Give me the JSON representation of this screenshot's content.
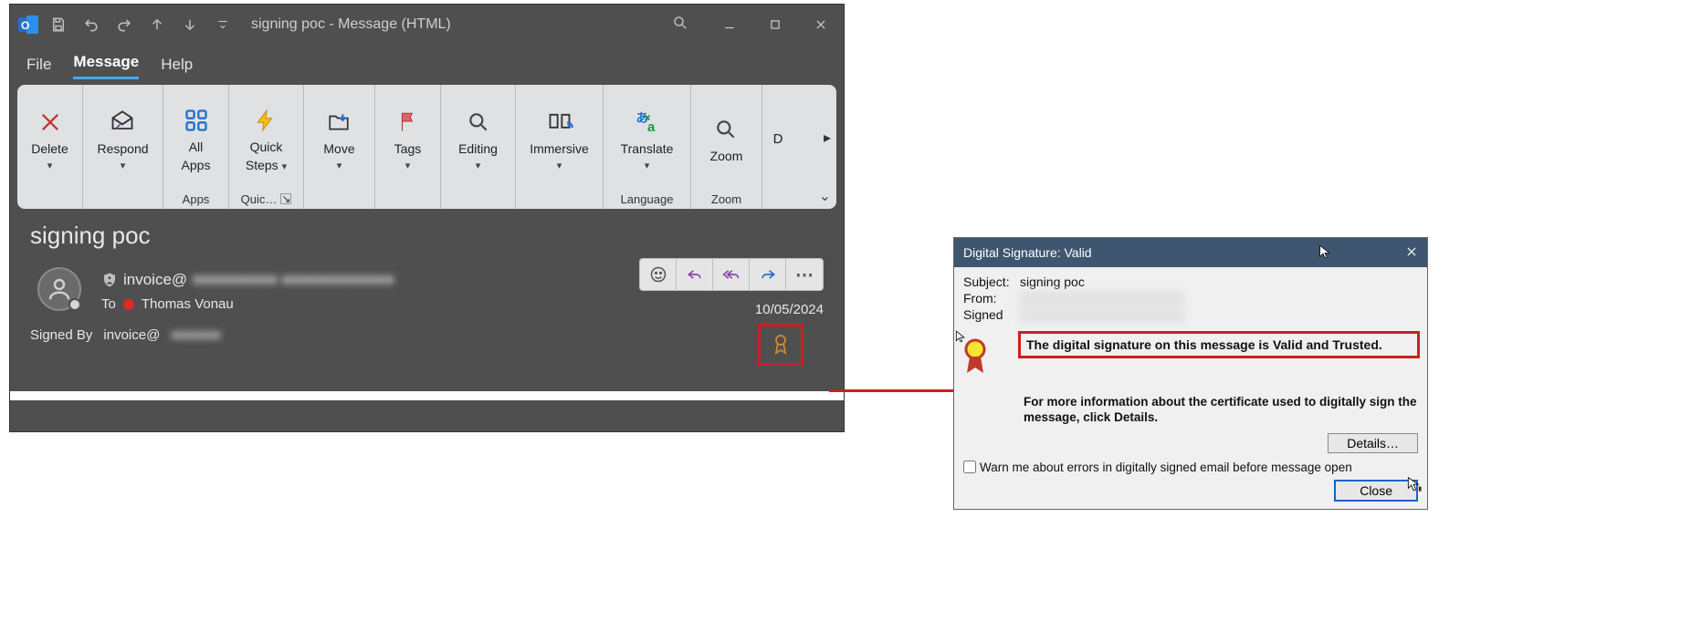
{
  "titlebar": {
    "title": "signing poc  -  Message (HTML)"
  },
  "menubar": {
    "file": "File",
    "message": "Message",
    "help": "Help"
  },
  "ribbon": {
    "delete": "Delete",
    "respond": "Respond",
    "all_apps_l1": "All",
    "all_apps_l2": "Apps",
    "quick_l1": "Quick",
    "quick_l2": "Steps",
    "move": "Move",
    "tags": "Tags",
    "editing": "Editing",
    "immersive": "Immersive",
    "translate": "Translate",
    "zoom": "Zoom",
    "grp_apps": "Apps",
    "grp_quick": "Quic…",
    "grp_lang": "Language",
    "grp_zoom": "Zoom",
    "overflow_hint": "D"
  },
  "message": {
    "subject": "signing poc",
    "from_prefix": "invoice@",
    "from_blur": "■■■■■■■■■  ■■■■■■■■■■■■",
    "to_label": "To",
    "to_name": "Thomas Vonau",
    "signed_by_label": "Signed By",
    "signed_by_value": "invoice@",
    "signed_by_blur": "■■■■■■",
    "date": "10/05/2024",
    "actions": {
      "more": "⋯"
    }
  },
  "dialog": {
    "title": "Digital Signature: Valid",
    "subject_k": "Subject:",
    "subject_v": "signing poc",
    "from_k": "From:",
    "signed_k": "Signed",
    "valid_msg": "The digital signature on this message is Valid and Trusted.",
    "more_info": "For more information about the certificate used to digitally sign the message, click Details.",
    "details_btn": "Details…",
    "warn_label": "Warn me about errors in digitally signed email before message open",
    "close_btn": "Close"
  }
}
